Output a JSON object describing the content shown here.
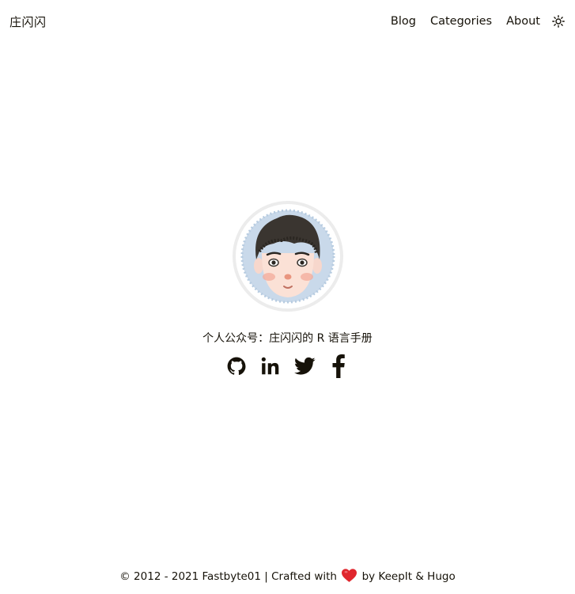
{
  "header": {
    "site_title": "庄闪闪",
    "nav": [
      {
        "label": "Blog"
      },
      {
        "label": "Categories"
      },
      {
        "label": "About"
      }
    ],
    "theme_toggle_icon": "sun-icon"
  },
  "profile": {
    "avatar_icon": "cartoon-face-avatar",
    "subtitle": "个人公众号：庄闪闪的 R 语言手册",
    "social_icons": [
      "github-icon",
      "linkedin-icon",
      "twitter-icon",
      "facebook-icon"
    ]
  },
  "footer": {
    "copyright": "© 2012 - 2021 Fastbyte01 | Crafted with",
    "heart_icon": "heart-icon",
    "credit": "by KeepIt & Hugo"
  },
  "colors": {
    "text": "#161209",
    "avatar_bg": "#c9d9ea",
    "avatar_border": "#ececec",
    "heart": "#e0262d"
  }
}
